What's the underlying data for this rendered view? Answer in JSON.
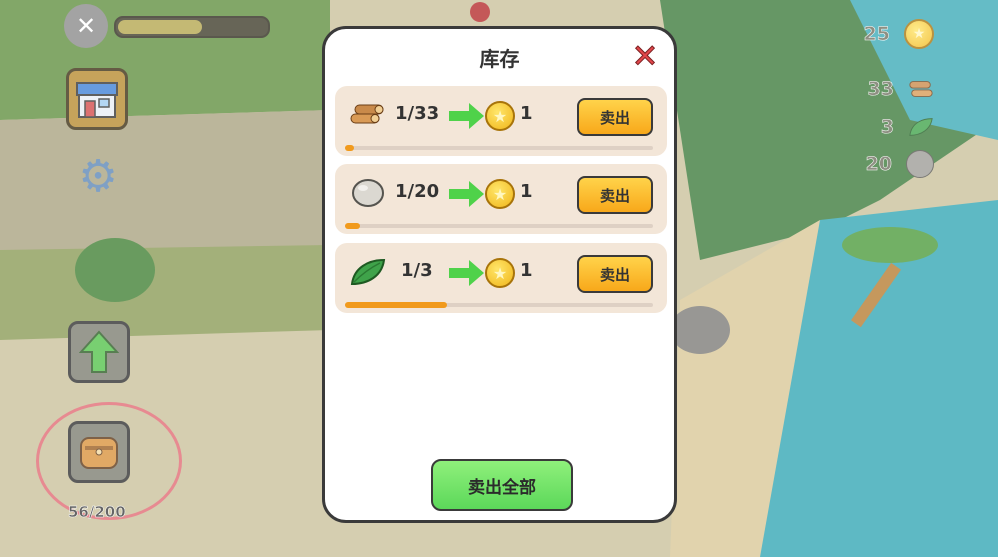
{
  "hud": {
    "food_level": 0.55,
    "bag_count": "56/200"
  },
  "resources": [
    {
      "value": "25",
      "icon": "coin-icon"
    },
    {
      "value": "33",
      "icon": "wood-icon"
    },
    {
      "value": "3",
      "icon": "leaf-icon"
    },
    {
      "value": "20",
      "icon": "stone-icon"
    }
  ],
  "inventory": {
    "title": "库存",
    "items": [
      {
        "icon": "wood-icon",
        "count": "1/33",
        "price": "1",
        "sell_label": "卖出",
        "progress": 0.03
      },
      {
        "icon": "stone-icon",
        "count": "1/20",
        "price": "1",
        "sell_label": "卖出",
        "progress": 0.05
      },
      {
        "icon": "leaf-icon",
        "count": "1/3",
        "price": "1",
        "sell_label": "卖出",
        "progress": 0.33
      }
    ],
    "sell_all_label": "卖出全部"
  },
  "colors": {
    "accent_orange": "#f8a81a",
    "sell_all_green": "#5cd85a",
    "close_red": "#e1474b"
  }
}
